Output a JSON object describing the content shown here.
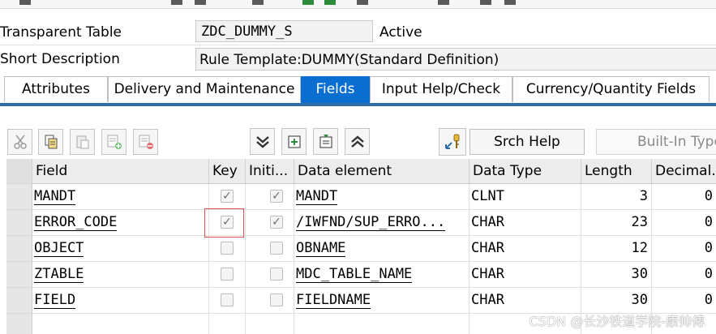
{
  "header": {
    "object_type_label": "Transparent Table",
    "object_name": "ZDC_DUMMY_S",
    "status": "Active",
    "short_desc_label": "Short Description",
    "short_desc_value": "Rule Template:DUMMY(Standard Definition)"
  },
  "tabs": [
    {
      "label": "Attributes"
    },
    {
      "label": "Delivery and Maintenance"
    },
    {
      "label": "Fields",
      "active": true
    },
    {
      "label": "Input Help/Check"
    },
    {
      "label": "Currency/Quantity Fields"
    }
  ],
  "toolbar": {
    "icons": [
      "cut-icon",
      "copy-icon",
      "paste-icon",
      "insert-row-icon",
      "delete-row-icon",
      "expand-down-icon",
      "new-entry-icon",
      "detail-icon",
      "collapse-up-icon",
      "search-help-key-icon"
    ],
    "srch_help_label": "Srch Help",
    "builtin_type_label": "Built-In Type"
  },
  "grid": {
    "columns": [
      "Field",
      "Key",
      "Initi...",
      "Data element",
      "Data Type",
      "Length",
      "Decimal..."
    ],
    "rows": [
      {
        "field": "MANDT",
        "key": true,
        "initial": true,
        "data_element": "MANDT",
        "data_type": "CLNT",
        "length": "3",
        "decimals": "0"
      },
      {
        "field": "ERROR_CODE",
        "key": true,
        "initial": true,
        "data_element": "/IWFND/SUP_ERRO...",
        "data_type": "CHAR",
        "length": "23",
        "decimals": "0"
      },
      {
        "field": "OBJECT",
        "key": false,
        "initial": false,
        "data_element": "OBNAME",
        "data_type": "CHAR",
        "length": "12",
        "decimals": "0"
      },
      {
        "field": "ZTABLE",
        "key": false,
        "initial": false,
        "data_element": "MDC_TABLE_NAME",
        "data_type": "CHAR",
        "length": "30",
        "decimals": "0"
      },
      {
        "field": "FIELD",
        "key": false,
        "initial": false,
        "data_element": "FIELDNAME",
        "data_type": "CHAR",
        "length": "30",
        "decimals": "0"
      }
    ]
  },
  "watermark": "CSDN @长沙铁道学院-康帅傅",
  "colors": {
    "accent": "#0a6ed1",
    "tab_underline": "#2d6fa8",
    "highlight": "#e25050"
  }
}
